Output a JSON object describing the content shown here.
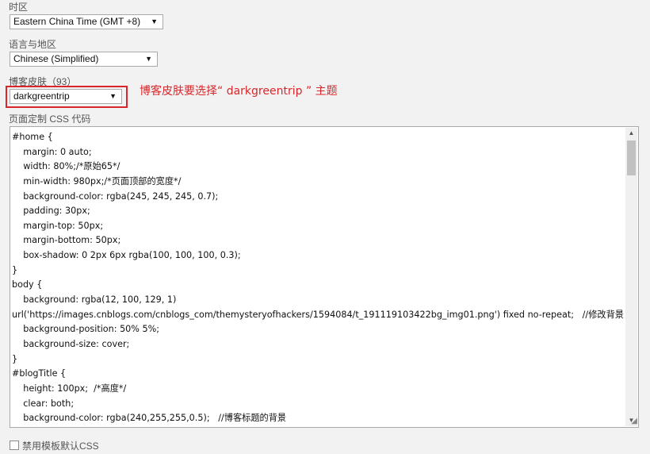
{
  "timezone": {
    "label": "时区",
    "selected": "Eastern China Time (GMT +8)"
  },
  "language": {
    "label": "语言与地区",
    "selected": "Chinese (Simplified)"
  },
  "skin": {
    "label": "博客皮肤（93）",
    "selected": "darkgreentrip"
  },
  "annotation": {
    "text": "博客皮肤要选择“ darkgreentrip ” 主题",
    "color": "#d9262b"
  },
  "css_editor": {
    "label": "页面定制 CSS 代码",
    "lines": [
      "#home {",
      "    margin: 0 auto;",
      "    width: 80%;/*原始65*/",
      "    min-width: 980px;/*页面顶部的宽度*/",
      "    background-color: rgba(245, 245, 245, 0.7);",
      "    padding: 30px;",
      "    margin-top: 50px;",
      "    margin-bottom: 50px;",
      "    box-shadow: 0 2px 6px rgba(100, 100, 100, 0.3);",
      "}",
      "body {",
      "    background: rgba(12, 100, 129, 1)",
      "url('https://images.cnblogs.com/cnblogs_com/themysteryofhackers/1594084/t_191119103422bg_img01.png') fixed no-repeat;   //修改背景图片",
      "    background-position: 50% 5%;",
      "    background-size: cover;",
      "}",
      "#blogTitle {",
      "    height: 100px;  /*高度*/",
      "    clear: both;",
      "    background-color: rgba(240,255,255,0.5);   //博客标题的背景"
    ]
  },
  "disable_default_css": {
    "label": "禁用模板默认CSS",
    "checked": false
  }
}
